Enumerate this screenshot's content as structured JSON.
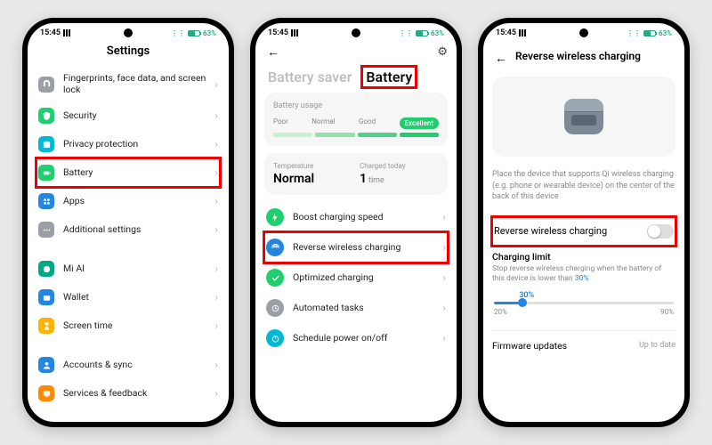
{
  "status": {
    "time": "15:45",
    "battery": "63%"
  },
  "screen1": {
    "title": "Settings",
    "items": [
      {
        "label": "Fingerprints, face data, and screen lock",
        "icon": "fingerprint-icon",
        "color": "c-gray"
      },
      {
        "label": "Security",
        "icon": "shield-icon",
        "color": "c-green"
      },
      {
        "label": "Privacy protection",
        "icon": "privacy-icon",
        "color": "c-cyan"
      },
      {
        "label": "Battery",
        "icon": "battery-icon",
        "color": "c-green"
      },
      {
        "label": "Apps",
        "icon": "apps-icon",
        "color": "c-blue"
      },
      {
        "label": "Additional settings",
        "icon": "dots-icon",
        "color": "c-gray"
      }
    ],
    "items2": [
      {
        "label": "Mi AI",
        "icon": "ai-icon",
        "color": "c-teal"
      },
      {
        "label": "Wallet",
        "icon": "wallet-icon",
        "color": "c-blue"
      },
      {
        "label": "Screen time",
        "icon": "hourglass-icon",
        "color": "c-yellow"
      }
    ],
    "items3": [
      {
        "label": "Accounts & sync",
        "icon": "user-icon",
        "color": "c-blue"
      },
      {
        "label": "Services & feedback",
        "icon": "feedback-icon",
        "color": "c-orange"
      }
    ]
  },
  "screen2": {
    "tab1": "Battery saver",
    "tab2": "Battery",
    "usage_title": "Battery usage",
    "levels": [
      "Poor",
      "Normal",
      "Good",
      "Excellent"
    ],
    "temp_label": "Temperature",
    "temp_value": "Normal",
    "charged_label": "Charged today",
    "charged_value": "1",
    "charged_unit": "time",
    "options": [
      {
        "label": "Boost charging speed",
        "icon": "bolt-icon",
        "color": "c-green"
      },
      {
        "label": "Reverse wireless charging",
        "icon": "wireless-icon",
        "color": "c-blue"
      },
      {
        "label": "Optimized charging",
        "icon": "check-icon",
        "color": "c-green"
      },
      {
        "label": "Automated tasks",
        "icon": "auto-icon",
        "color": "c-gray"
      },
      {
        "label": "Schedule power on/off",
        "icon": "power-icon",
        "color": "c-cyan"
      }
    ]
  },
  "screen3": {
    "title": "Reverse wireless charging",
    "desc": "Place the device that supports Qi wireless charging (e.g. phone or wearable device) on the center of the back of this device",
    "toggle_label": "Reverse wireless charging",
    "limit_title": "Charging limit",
    "limit_desc_a": "Stop reverse wireless charging when the battery of this device is lower than ",
    "limit_desc_b": "30%",
    "slider_value": "30%",
    "slider_min": "20%",
    "slider_max": "90%",
    "firmware_label": "Firmware updates",
    "firmware_status": "Up to date"
  }
}
